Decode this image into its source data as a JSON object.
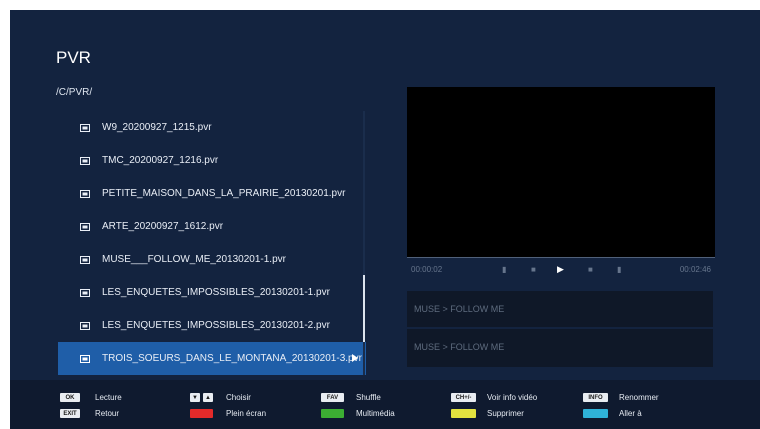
{
  "title": "PVR",
  "path": "/C/PVR/",
  "files": [
    "W9_20200927_1215.pvr",
    "TMC_20200927_1216.pvr",
    "PETITE_MAISON_DANS_LA_PRAIRIE_20130201.pvr",
    "ARTE_20200927_1612.pvr",
    "MUSE___FOLLOW_ME_20130201-1.pvr",
    "LES_ENQUETES_IMPOSSIBLES_20130201-1.pvr",
    "LES_ENQUETES_IMPOSSIBLES_20130201-2.pvr",
    "TROIS_SOEURS_DANS_LE_MONTANA_20130201-3.pvr"
  ],
  "selected_index": 7,
  "player": {
    "time_start": "00:00:02",
    "time_end": "00:02:46"
  },
  "info": {
    "line1": "MUSE > FOLLOW ME",
    "line2": "MUSE > FOLLOW ME"
  },
  "footer": {
    "ok_key": "OK",
    "ok_label": "Lecture",
    "exit_key": "EXIT",
    "exit_label": "Retour",
    "choose_label": "Choisir",
    "red_label": "Plein écran",
    "fav_key": "FAV",
    "fav_label": "Shuffle",
    "green_label": "Multimédia",
    "chplus_key": "CH+/-",
    "chplus_label": "Voir info vidéo",
    "yellow_label": "Supprimer",
    "info_key": "INFO",
    "info_label": "Renommer",
    "blue_label": "Aller à"
  },
  "colors": {
    "background": "#13233f",
    "selected": "#1f5ea8",
    "red": "#e32a2a",
    "green": "#3cae33",
    "yellow": "#e2e23f",
    "blue": "#2fb2d8"
  },
  "icons": {
    "file": "video-file-icon",
    "play": "play-icon",
    "caret": "caret-right-icon"
  }
}
